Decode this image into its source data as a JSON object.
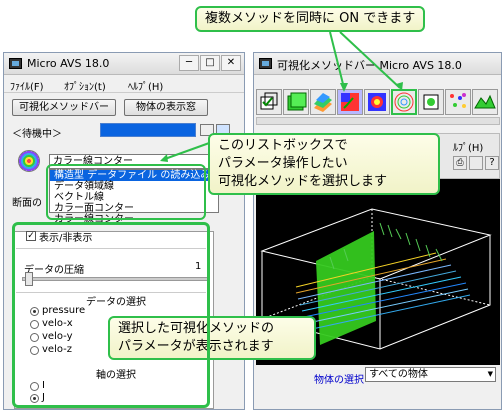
{
  "left_window": {
    "title": "Micro AVS 18.0",
    "menu": [
      "ﾌｧｲﾙ(F)",
      "ｵﾌﾟｼｮﾝ(t)",
      "ﾍﾙﾌﾟ(H)"
    ],
    "buttons": {
      "method_bar": "可視化メソッドバー",
      "object_display": "物体の表示窓"
    },
    "status": "＜待機中＞",
    "method_combo": "カラー線コンター",
    "method_options": [
      "構造型 データファイル の読み込み",
      "データ領域線",
      "ベクトル線",
      "カラー面コンター",
      "カラー線コンター"
    ],
    "section_label": "断面の",
    "params": {
      "show_hide_label": "表示/非表示",
      "compress_label": "データの圧縮",
      "compress_value": "1",
      "data_select_title": "データの選択",
      "data_options": [
        "pressure",
        "velo-x",
        "velo-y",
        "velo-z"
      ],
      "data_selected": 0,
      "axis_select_title": "軸の選択",
      "axis_options": [
        "I",
        "J"
      ],
      "axis_selected": 1
    }
  },
  "right_window": {
    "title": "可視化メソッドバー Micro AVS 18.0",
    "viewer_menu": "ﾙﾌﾟ(H)",
    "object_select_label": "物体の選択",
    "object_select_value": "すべての物体"
  },
  "callouts": {
    "top": "複数メソッドを同時に ON できます",
    "middle": [
      "このリストボックスで",
      "パラメータ操作したい",
      "可視化メソッドを選択します"
    ],
    "bottom": [
      "選択した可視化メソッドの",
      "パラメータが表示されます"
    ]
  },
  "colors": {
    "callout_border": "#2fbf4a",
    "selection": "#0a64e0"
  }
}
